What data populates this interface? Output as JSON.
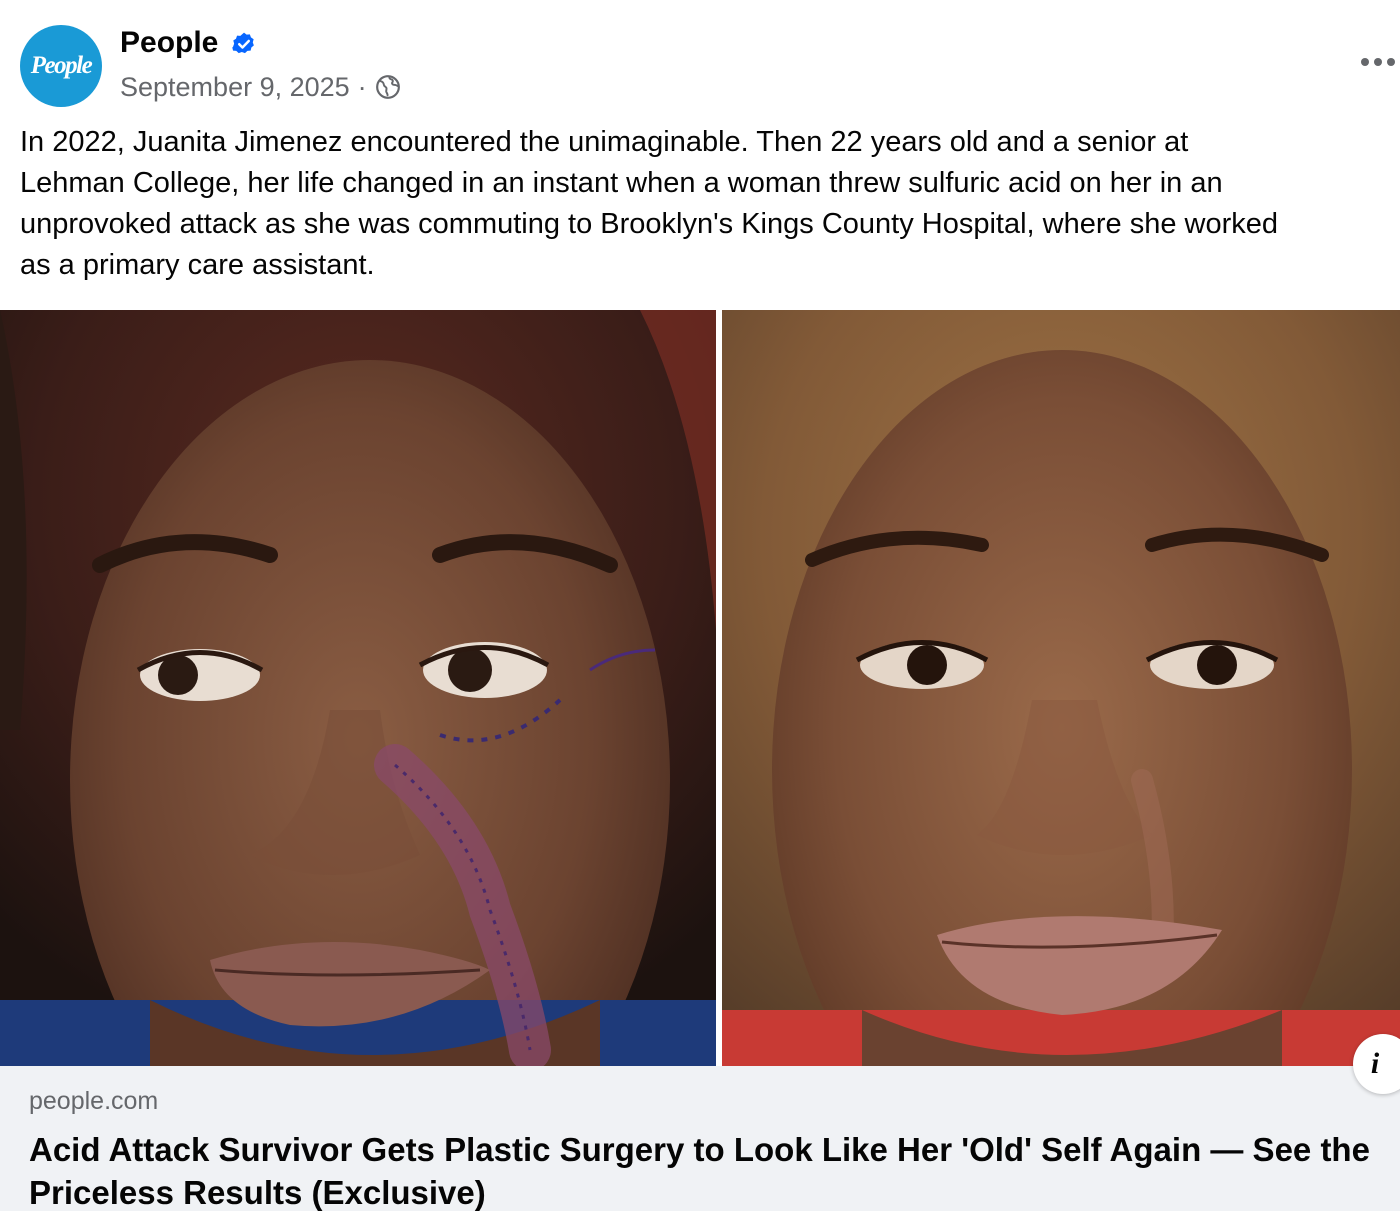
{
  "post": {
    "author": {
      "avatar_text": "People",
      "name": "People",
      "verified": true
    },
    "date": "September 9, 2025",
    "separator": "·",
    "audience_icon": "globe-icon",
    "more_icon": "more-options-icon",
    "caption_lines": [
      "In 2022, Juanita Jimenez encountered the unimaginable. Then 22 years old and a senior at",
      "Lehman College, her life changed in an instant when a woman threw sulfuric acid on her in an",
      "unprovoked attack as she was commuting to Brooklyn's Kings County Hospital, where she worked",
      "as a primary care assistant."
    ],
    "image": {
      "panels": [
        "before-surgery-photo",
        "after-surgery-photo"
      ],
      "info_glyph": "i"
    },
    "link": {
      "domain": "people.com",
      "title": "Acid Attack Survivor Gets Plastic Surgery to Look Like Her 'Old' Self Again — See the Priceless Results (Exclusive)"
    }
  },
  "colors": {
    "brand_avatar": "#1a9ad6",
    "verified_blue": "#0866ff",
    "secondary_text": "#65676b",
    "primary_text": "#050505",
    "link_background": "#f0f2f5"
  }
}
